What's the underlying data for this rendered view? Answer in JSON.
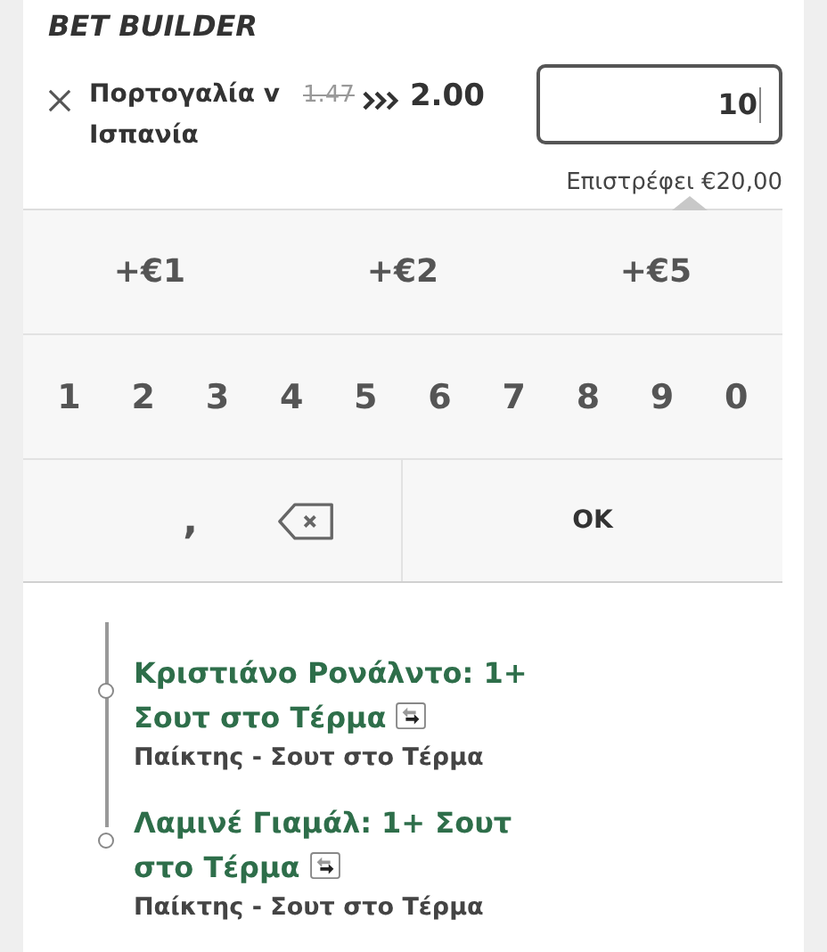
{
  "header": {
    "title": "BET BUILDER"
  },
  "selection": {
    "match": "Πορτογαλία v Ισπανία",
    "old_odds": "1.47",
    "new_odds": "2.00",
    "stake": "10",
    "returns": "Επιστρέφει €20,00"
  },
  "quick_stakes": [
    "+€1",
    "+€2",
    "+€5"
  ],
  "digits": [
    "1",
    "2",
    "3",
    "4",
    "5",
    "6",
    "7",
    "8",
    "9",
    "0"
  ],
  "bottom_keys": [
    {
      "kind": "comma",
      "label": ","
    },
    {
      "kind": "backspace"
    },
    {
      "kind": "ok",
      "label": "OK"
    }
  ],
  "legs": [
    {
      "title": "Κριστιάνο Ρονάλντο: 1+ Σουτ στο Τέρμα",
      "market": "Παίκτης - Σουτ στο Τέρμα"
    },
    {
      "title": "Λαμινέ Γιαμάλ: 1+ Σουτ στο Τέρμα",
      "market": "Παίκτης - Σουτ στο Τέρμα"
    }
  ]
}
